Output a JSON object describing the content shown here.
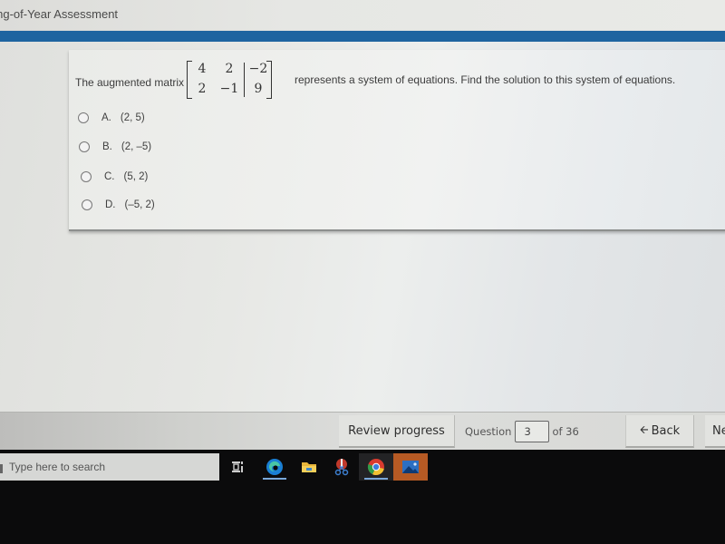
{
  "window": {
    "title": "ning-of-Year Assessment"
  },
  "question": {
    "prefix": "The augmented matrix",
    "matrix": {
      "rows": [
        [
          "4",
          "2",
          "−2"
        ],
        [
          "2",
          "−1",
          "9"
        ]
      ]
    },
    "suffix": "represents a system of equations. Find the solution to this system of equations.",
    "choices": [
      {
        "letter": "A.",
        "text": "(2, 5)",
        "selected": false
      },
      {
        "letter": "B.",
        "text": "(2, –5)",
        "selected": false
      },
      {
        "letter": "C.",
        "text": "(5, 2)",
        "selected": false
      },
      {
        "letter": "D.",
        "text": "(–5, 2)",
        "selected": false
      }
    ]
  },
  "nav": {
    "review_label": "Review progress",
    "question_label": "Question",
    "question_value": "3",
    "question_total": "of 36",
    "back_label": "Back",
    "back_icon": "arrow-left-icon",
    "next_label": "Ne"
  },
  "taskbar": {
    "search_placeholder": "Type here to search",
    "icons": [
      "task-view-icon",
      "edge-icon",
      "file-explorer-icon",
      "snipping-tool-icon",
      "chrome-icon",
      "photos-icon"
    ]
  },
  "colors": {
    "accent_bar": "#1e64a0",
    "taskbar": "#0b0b0c"
  }
}
